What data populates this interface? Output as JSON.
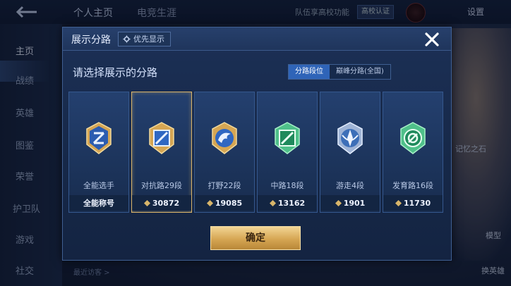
{
  "background": {
    "tabs": [
      "个人主页",
      "电竞生涯"
    ],
    "notice": "队伍享高校功能",
    "campus_badge": "高校认证",
    "settings": "设置",
    "sidebar": [
      "主页",
      "战绩",
      "英雄",
      "图鉴",
      "荣誉",
      "护卫队",
      "游戏",
      "社交"
    ],
    "right_labels": [
      "记忆之石",
      "模型",
      "换英雄"
    ],
    "visitors": "最近访客 >"
  },
  "modal": {
    "title": "展示分路",
    "priority_button": "优先显示",
    "close_icon": "close-icon",
    "subtitle": "请选择展示的分路",
    "segments": [
      {
        "label": "分路段位",
        "active": true
      },
      {
        "label": "巅峰分路(全国)",
        "active": false
      }
    ],
    "cards": [
      {
        "name": "全能选手",
        "value": "全能称号",
        "icon": "all-round-emblem-icon",
        "selected": false,
        "show_diamond": false
      },
      {
        "name": "对抗路29段",
        "value": "30872",
        "icon": "clash-lane-emblem-icon",
        "selected": true,
        "show_diamond": true
      },
      {
        "name": "打野22段",
        "value": "19085",
        "icon": "jungle-emblem-icon",
        "selected": false,
        "show_diamond": true
      },
      {
        "name": "中路18段",
        "value": "13162",
        "icon": "mid-lane-emblem-icon",
        "selected": false,
        "show_diamond": true
      },
      {
        "name": "游走4段",
        "value": "1901",
        "icon": "roam-emblem-icon",
        "selected": false,
        "show_diamond": true
      },
      {
        "name": "发育路16段",
        "value": "11730",
        "icon": "farm-lane-emblem-icon",
        "selected": false,
        "show_diamond": true
      }
    ],
    "confirm": "确定"
  },
  "colors": {
    "accent_blue": "#2f64b8",
    "gold_button": "#d6a653",
    "selected_border": "#d9b46a",
    "panel": "#162848"
  }
}
